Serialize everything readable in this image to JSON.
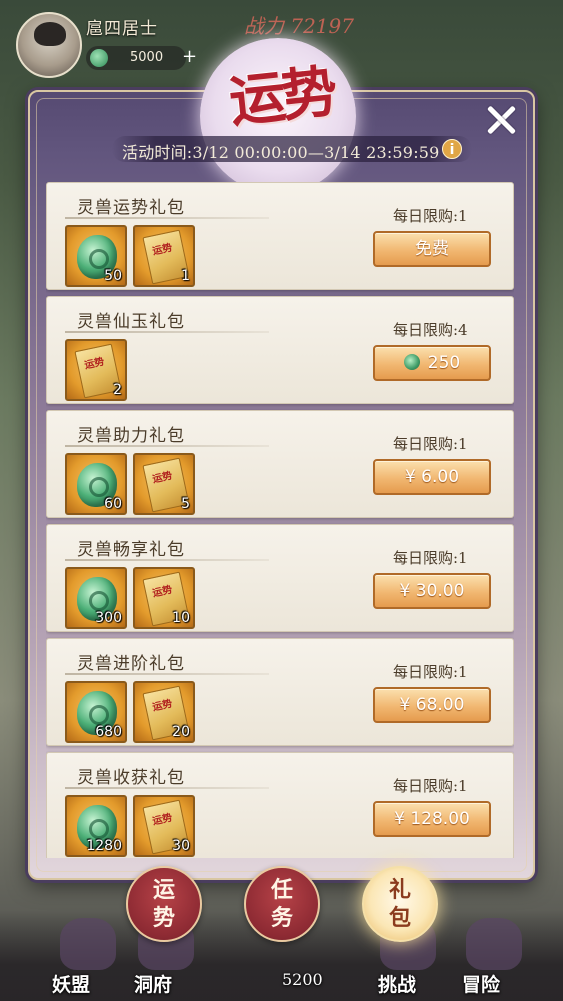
{
  "hud": {
    "player_name": "扈四居士",
    "currency_value": "5000",
    "power_text": "战力 72197",
    "plus": "+"
  },
  "bottom_nav": {
    "items": [
      {
        "label": "妖盟",
        "icon": "alliance-icon"
      },
      {
        "label": "洞府",
        "icon": "cave-icon"
      },
      {
        "label": "5200",
        "icon": ""
      },
      {
        "label": "挑战",
        "icon": "challenge-icon"
      },
      {
        "label": "冒险",
        "icon": "adventure-icon"
      }
    ]
  },
  "modal": {
    "title": "运势",
    "activity_time": "活动时间:3/12 00:00:00—3/14 23:59:59",
    "info": "i",
    "packs": [
      {
        "name": "灵兽运势礼包",
        "limit": "每日限购:1",
        "price": "免费",
        "price_icon": "",
        "items": [
          {
            "icon": "jade-dragon-icon",
            "qty": "50"
          },
          {
            "icon": "fortune-scroll-icon",
            "qty": "1"
          }
        ]
      },
      {
        "name": "灵兽仙玉礼包",
        "limit": "每日限购:4",
        "price": "250",
        "price_icon": "jade-currency-icon",
        "items": [
          {
            "icon": "fortune-scroll-icon",
            "qty": "2"
          }
        ]
      },
      {
        "name": "灵兽助力礼包",
        "limit": "每日限购:1",
        "price": "¥ 6.00",
        "price_icon": "",
        "items": [
          {
            "icon": "jade-dragon-icon",
            "qty": "60"
          },
          {
            "icon": "fortune-scroll-icon",
            "qty": "5"
          }
        ]
      },
      {
        "name": "灵兽畅享礼包",
        "limit": "每日限购:1",
        "price": "¥ 30.00",
        "price_icon": "",
        "items": [
          {
            "icon": "jade-dragon-icon",
            "qty": "300"
          },
          {
            "icon": "fortune-scroll-icon",
            "qty": "10"
          }
        ]
      },
      {
        "name": "灵兽进阶礼包",
        "limit": "每日限购:1",
        "price": "¥ 68.00",
        "price_icon": "",
        "items": [
          {
            "icon": "jade-dragon-icon",
            "qty": "680"
          },
          {
            "icon": "fortune-scroll-icon",
            "qty": "20"
          }
        ]
      },
      {
        "name": "灵兽收获礼包",
        "limit": "每日限购:1",
        "price": "¥ 128.00",
        "price_icon": "",
        "items": [
          {
            "icon": "jade-dragon-icon",
            "qty": "1280"
          },
          {
            "icon": "fortune-scroll-icon",
            "qty": "30"
          }
        ]
      }
    ]
  },
  "tabs": [
    {
      "label": "运势",
      "active": false
    },
    {
      "label": "任务",
      "active": false
    },
    {
      "label": "礼包",
      "active": true
    }
  ],
  "colors": {
    "title_red": "#b4202e",
    "button_orange": "#f1b771",
    "tab_red": "#8d2a33"
  }
}
